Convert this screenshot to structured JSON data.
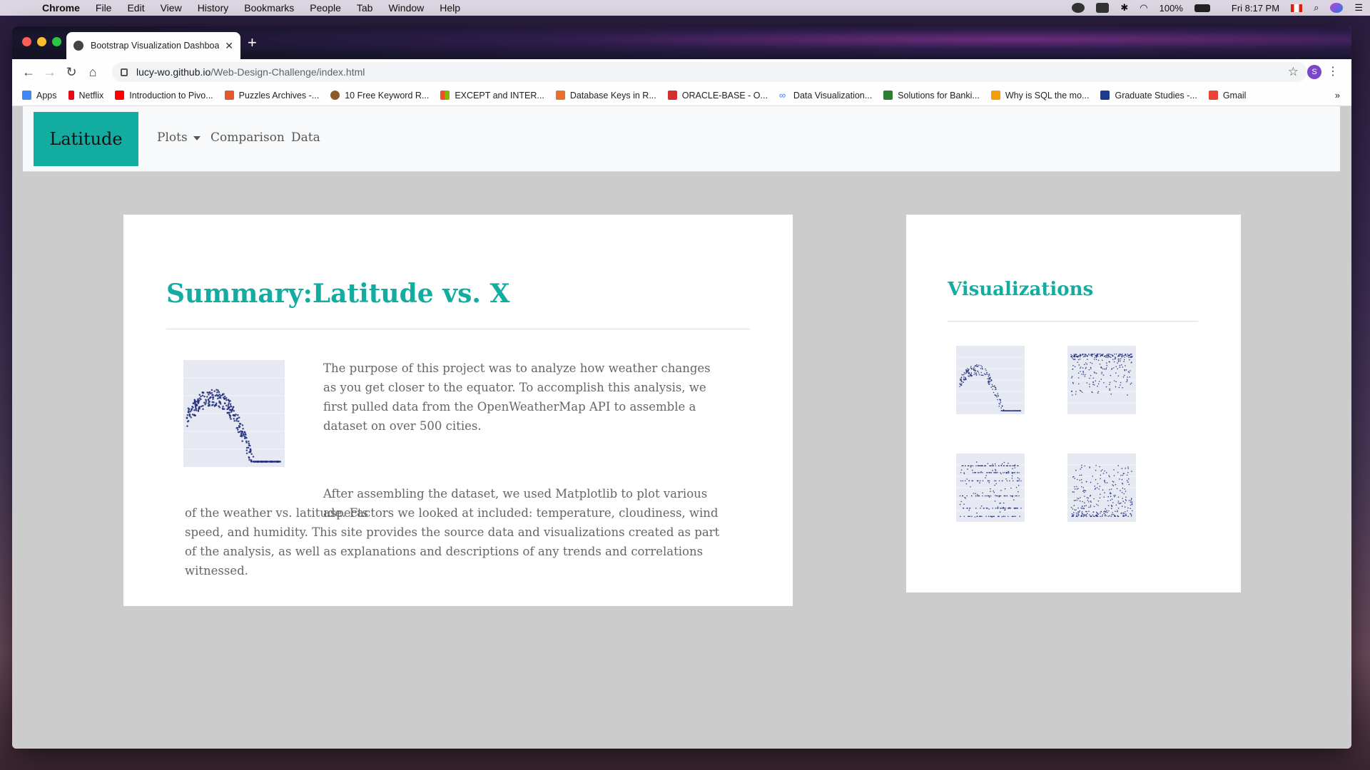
{
  "menubar": {
    "app": "Chrome",
    "items": [
      "File",
      "Edit",
      "View",
      "History",
      "Bookmarks",
      "People",
      "Tab",
      "Window",
      "Help"
    ],
    "battery": "100%",
    "clock": "Fri 8:17 PM"
  },
  "browser": {
    "tab_title": "Bootstrap Visualization Dashboard",
    "url_host": "lucy-wo.github.io",
    "url_path": "/Web-Design-Challenge/index.html",
    "profile_initial": "S",
    "bookmarks": [
      {
        "label": "Apps",
        "color": "#4285f4"
      },
      {
        "label": "Netflix",
        "color": "#e50914"
      },
      {
        "label": "Introduction to Pivo...",
        "color": "#ff0000"
      },
      {
        "label": "Puzzles Archives -...",
        "color": "#e4572e"
      },
      {
        "label": "10 Free Keyword R...",
        "color": "#8b5a2b"
      },
      {
        "label": "EXCEPT and INTER...",
        "color": "#00a4ef"
      },
      {
        "label": "Database Keys in R...",
        "color": "#e86f2c"
      },
      {
        "label": "ORACLE-BASE - O...",
        "color": "#d32f2f"
      },
      {
        "label": "Data Visualization...",
        "color": "#3b82f6"
      },
      {
        "label": "Solutions for Banki...",
        "color": "#2e7d32"
      },
      {
        "label": "Why is SQL the mo...",
        "color": "#f59e0b"
      },
      {
        "label": "Graduate Studies -...",
        "color": "#1e3a8a"
      },
      {
        "label": "Gmail",
        "color": "#ea4335"
      }
    ]
  },
  "site": {
    "brand": "Latitude",
    "nav": {
      "plots": "Plots",
      "comparison": "Comparison",
      "data": "Data"
    },
    "summary": {
      "title": "Summary:Latitude vs. X",
      "para1": "The purpose of this project was to analyze how weather changes as you get closer to the equator. To accomplish this analysis, we first pulled data from the OpenWeatherMap API to assemble a dataset on over 500 cities.",
      "para2_first": "After assembling the dataset, we used Matplotlib to plot various aspects",
      "para2_rest": "of the weather vs. latitude. Factors we looked at included: temperature, cloudiness, wind speed, and humidity. This site provides the source data and visualizations created as part of the analysis, as well as explanations and descriptions of any trends and correlations witnessed."
    },
    "visualizations": {
      "title": "Visualizations"
    },
    "accent_color": "#13aca1"
  }
}
